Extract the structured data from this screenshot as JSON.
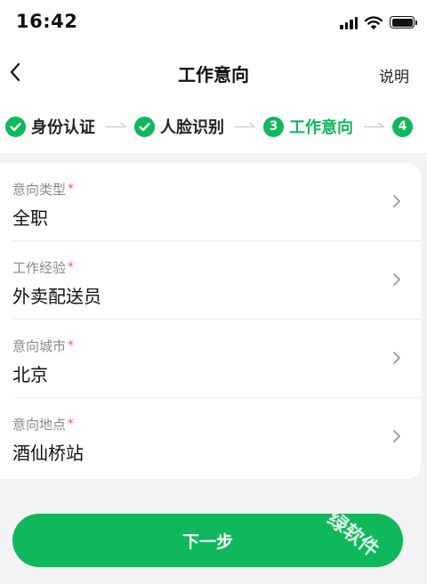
{
  "status_bar": {
    "time": "16:42"
  },
  "nav": {
    "title": "工作意向",
    "action_label": "说明"
  },
  "steps": [
    {
      "label": "身份认证",
      "state": "done"
    },
    {
      "label": "人脸识别",
      "state": "done"
    },
    {
      "number": "3",
      "label": "工作意向",
      "state": "current"
    },
    {
      "number": "4",
      "label": "",
      "state": "pending"
    }
  ],
  "form": {
    "fields": [
      {
        "label": "意向类型",
        "required_mark": "*",
        "value": "全职"
      },
      {
        "label": "工作经验",
        "required_mark": "*",
        "value": "外卖配送员"
      },
      {
        "label": "意向城市",
        "required_mark": "*",
        "value": "北京"
      },
      {
        "label": "意向地点",
        "required_mark": "*",
        "value": "酒仙桥站"
      }
    ]
  },
  "next_button": {
    "label": "下一步"
  },
  "watermark": {
    "text": "绿软件"
  },
  "colors": {
    "accent": "#0fb85a",
    "required": "#f04d4d",
    "page_background": "#f3f3f5",
    "label_gray": "#8a8a8a"
  },
  "icons": {
    "back": "chevron-left-icon",
    "step_done": "check-circle-icon",
    "step_separator": "arrow-right-icon",
    "row": "chevron-right-icon",
    "wifi": "wifi-icon",
    "battery": "battery-icon",
    "signal": "cellular-signal-icon"
  }
}
